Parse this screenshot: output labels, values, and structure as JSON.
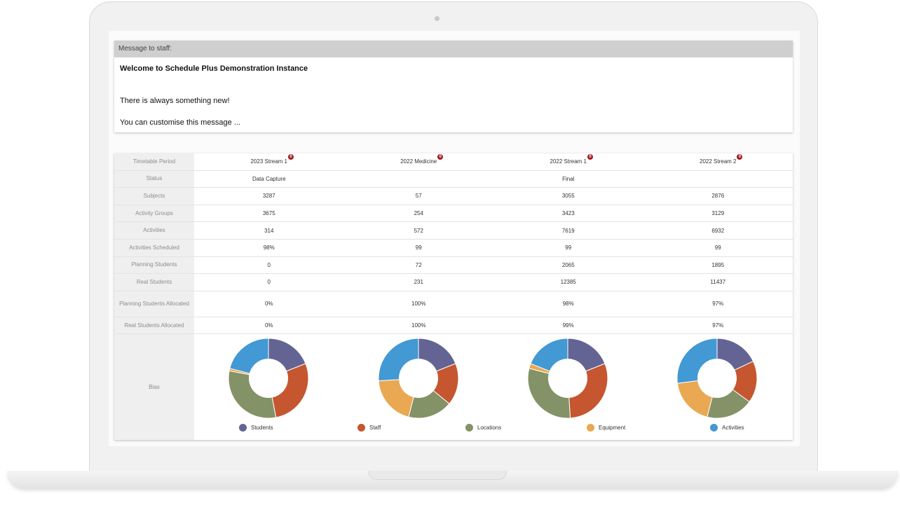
{
  "message": {
    "header": "Message to staff:",
    "title": "Welcome to Schedule Plus Demonstration Instance",
    "line1": "There is always something new!",
    "line2": "You can customise this message ..."
  },
  "table": {
    "header_label": "Timetable Period",
    "periods": [
      {
        "name": "2023 Stream 1",
        "badge": "0"
      },
      {
        "name": "2022 Medicine",
        "badge": "0"
      },
      {
        "name": "2022 Stream 1",
        "badge": "0"
      },
      {
        "name": "2022 Stream 2",
        "badge": "0"
      }
    ],
    "rows": [
      {
        "label": "Status",
        "values": [
          "Data Capture",
          "",
          "Final",
          ""
        ]
      },
      {
        "label": "Subjects",
        "values": [
          "3287",
          "57",
          "3055",
          "2876"
        ]
      },
      {
        "label": "Activity Groups",
        "values": [
          "3675",
          "254",
          "3423",
          "3129"
        ]
      },
      {
        "label": "Activities",
        "values": [
          "314",
          "572",
          "7619",
          "6932"
        ]
      },
      {
        "label": "Activities Scheduled",
        "values": [
          "98%",
          "99",
          "99",
          "99"
        ]
      },
      {
        "label": "Planning Students",
        "values": [
          "0",
          "72",
          "2065",
          "1895"
        ]
      },
      {
        "label": "Real Students",
        "values": [
          "0",
          "231",
          "12385",
          "11437"
        ]
      },
      {
        "label": "Planning Students Allocated",
        "values": [
          "0%",
          "100%",
          "98%",
          "97%"
        ]
      },
      {
        "label": "Real Students Allocated",
        "values": [
          "0%",
          "100%",
          "99%",
          "97%"
        ]
      }
    ],
    "bias_label": "Bias"
  },
  "chart_data": [
    {
      "type": "pie",
      "categories": [
        "Students",
        "Staff",
        "Locations",
        "Equipment",
        "Activities"
      ],
      "values": [
        19,
        28,
        31,
        1,
        21
      ]
    },
    {
      "type": "pie",
      "categories": [
        "Students",
        "Staff",
        "Locations",
        "Equipment",
        "Activities"
      ],
      "values": [
        19,
        17,
        18,
        20,
        26
      ]
    },
    {
      "type": "pie",
      "categories": [
        "Students",
        "Staff",
        "Locations",
        "Equipment",
        "Activities"
      ],
      "values": [
        19,
        30,
        30,
        2,
        19
      ]
    },
    {
      "type": "pie",
      "categories": [
        "Students",
        "Staff",
        "Locations",
        "Equipment",
        "Activities"
      ],
      "values": [
        18,
        17,
        19,
        19,
        27
      ]
    }
  ],
  "legend": [
    {
      "name": "Students",
      "color": "#646494"
    },
    {
      "name": "Staff",
      "color": "#c5562f"
    },
    {
      "name": "Locations",
      "color": "#849267"
    },
    {
      "name": "Equipment",
      "color": "#e9a851"
    },
    {
      "name": "Activities",
      "color": "#4299d3"
    }
  ]
}
